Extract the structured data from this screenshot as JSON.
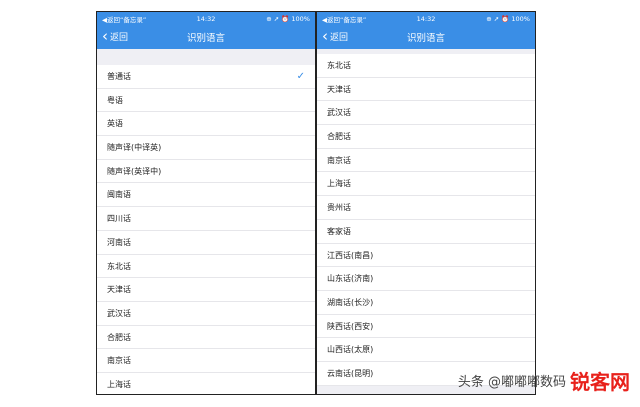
{
  "left_phone": {
    "status": {
      "carrier": "◀返回“备忘录”",
      "time": "14:32",
      "battery": "⊕ ➚ ⏰ 100%"
    },
    "nav": {
      "back_label": "返回",
      "title": "识别语言"
    },
    "items": [
      "普通话",
      "粤语",
      "英语",
      "随声译(中译英)",
      "随声译(英译中)",
      "闽南语",
      "四川话",
      "河南话",
      "东北话",
      "天津话",
      "武汉话",
      "合肥话",
      "南京话",
      "上海话"
    ],
    "selected_index": 0
  },
  "right_phone": {
    "status": {
      "carrier": "◀返回“备忘录”",
      "time": "14:32",
      "battery": "⊕ ➚ ⏰ 100%"
    },
    "nav": {
      "back_label": "返回",
      "title": "识别语言"
    },
    "items": [
      "东北话",
      "天津话",
      "武汉话",
      "合肥话",
      "南京话",
      "上海话",
      "贵州话",
      "客家语",
      "江西话(南昌)",
      "山东话(济南)",
      "湖南话(长沙)",
      "陕西话(西安)",
      "山西话(太原)",
      "云南话(昆明)"
    ]
  },
  "watermark": {
    "text": "头条 @嘟嘟嘟数码",
    "logo": "锐客网"
  },
  "colors": {
    "accent": "#3a8ee6",
    "logo": "#e8211b"
  }
}
